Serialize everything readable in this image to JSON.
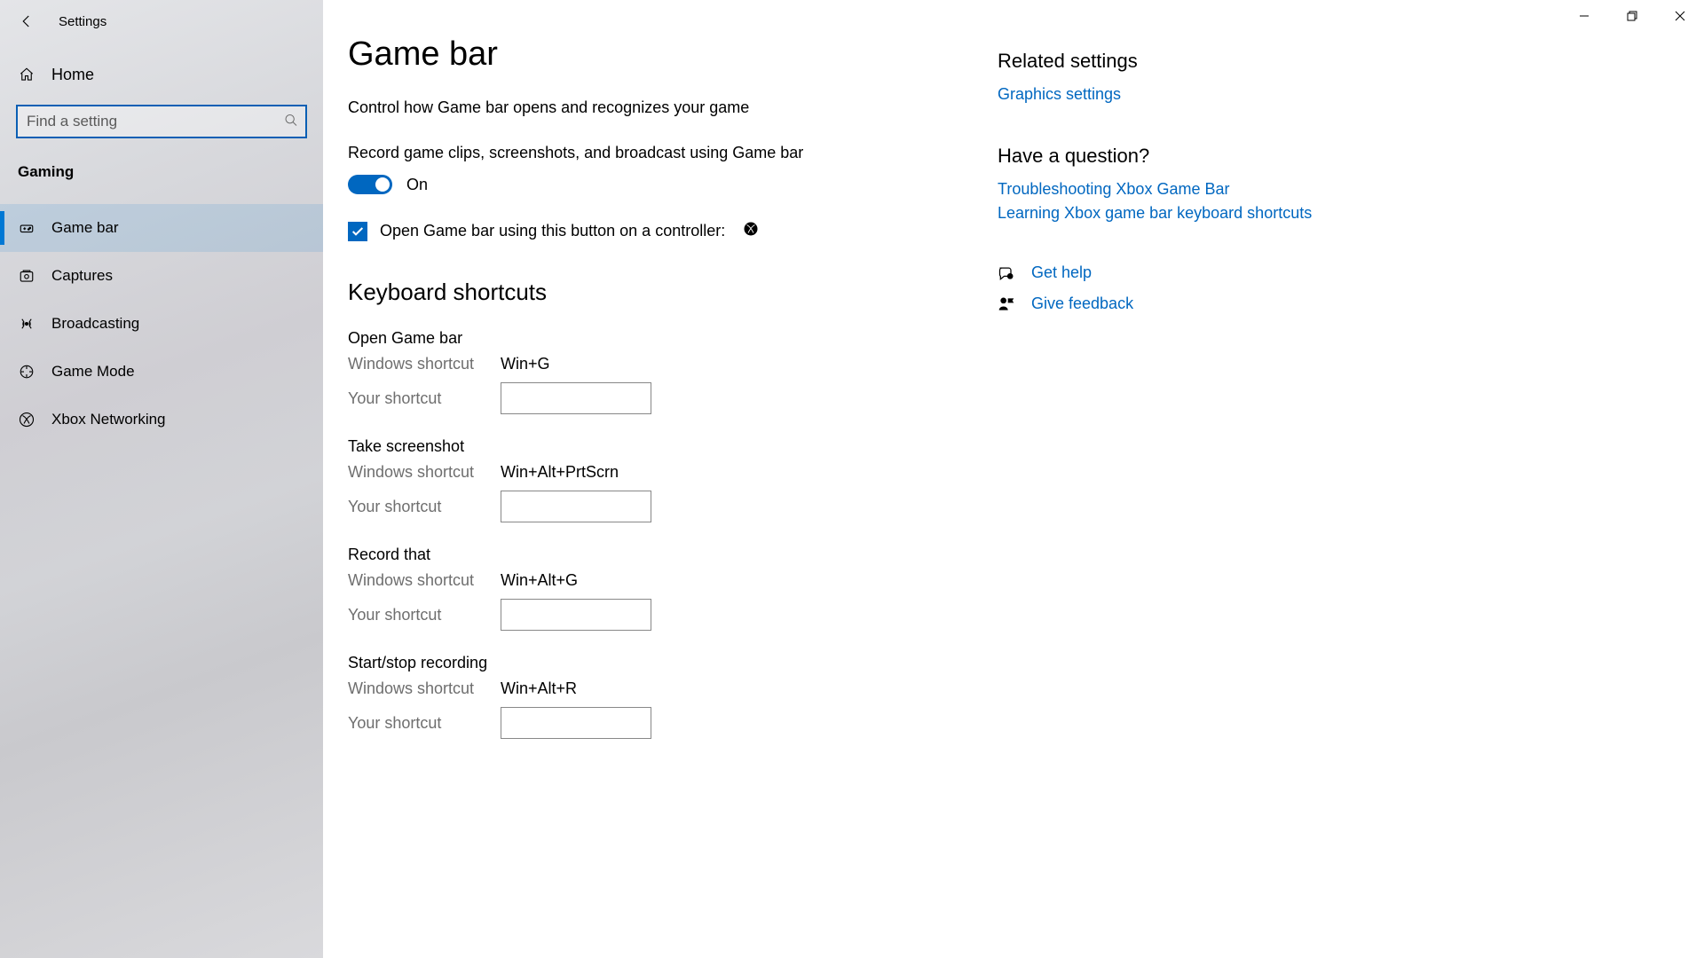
{
  "window": {
    "title": "Settings"
  },
  "sidebar": {
    "home_label": "Home",
    "search_placeholder": "Find a setting",
    "category_label": "Gaming",
    "items": [
      {
        "label": "Game bar"
      },
      {
        "label": "Captures"
      },
      {
        "label": "Broadcasting"
      },
      {
        "label": "Game Mode"
      },
      {
        "label": "Xbox Networking"
      }
    ]
  },
  "main": {
    "title": "Game bar",
    "description": "Control how Game bar opens and recognizes your game",
    "record_desc": "Record game clips, screenshots, and broadcast using Game bar",
    "toggle_label": "On",
    "controller_label": "Open Game bar using this button on a controller:",
    "shortcuts_heading": "Keyboard shortcuts",
    "win_shortcut_label": "Windows shortcut",
    "your_shortcut_label": "Your shortcut",
    "shortcuts": [
      {
        "title": "Open Game bar",
        "win": "Win+G"
      },
      {
        "title": "Take screenshot",
        "win": "Win+Alt+PrtScrn"
      },
      {
        "title": "Record that",
        "win": "Win+Alt+G"
      },
      {
        "title": "Start/stop recording",
        "win": "Win+Alt+R"
      }
    ]
  },
  "right": {
    "related_heading": "Related settings",
    "related_link": "Graphics settings",
    "question_heading": "Have a question?",
    "q_link1": "Troubleshooting Xbox Game Bar",
    "q_link2": "Learning Xbox game bar keyboard shortcuts",
    "help_label": "Get help",
    "feedback_label": "Give feedback"
  }
}
